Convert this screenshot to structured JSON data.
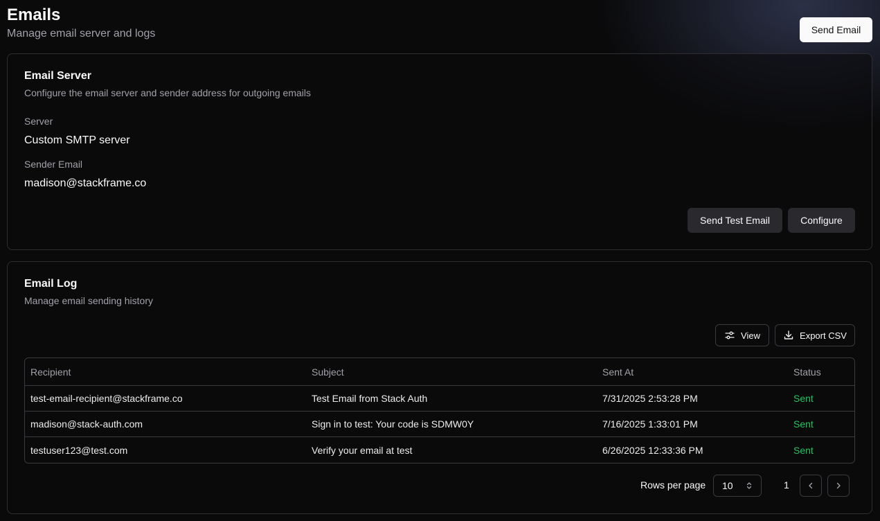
{
  "header": {
    "title": "Emails",
    "subtitle": "Manage email server and logs",
    "send_email_label": "Send Email"
  },
  "email_server": {
    "title": "Email Server",
    "description": "Configure the email server and sender address for outgoing emails",
    "server_label": "Server",
    "server_value": "Custom SMTP server",
    "sender_label": "Sender Email",
    "sender_value": "madison@stackframe.co",
    "send_test_label": "Send Test Email",
    "configure_label": "Configure"
  },
  "email_log": {
    "title": "Email Log",
    "description": "Manage email sending history",
    "view_label": "View",
    "view_icon": "sliders-icon",
    "export_label": "Export CSV",
    "export_icon": "download-icon",
    "columns": [
      "Recipient",
      "Subject",
      "Sent At",
      "Status"
    ],
    "rows": [
      {
        "recipient": "test-email-recipient@stackframe.co",
        "subject": "Test Email from Stack Auth",
        "sent_at": "7/31/2025 2:53:28 PM",
        "status": "Sent"
      },
      {
        "recipient": "madison@stack-auth.com",
        "subject": "Sign in to test: Your code is SDMW0Y",
        "sent_at": "7/16/2025 1:33:01 PM",
        "status": "Sent"
      },
      {
        "recipient": "testuser123@test.com",
        "subject": "Verify your email at test",
        "sent_at": "6/26/2025 12:33:36 PM",
        "status": "Sent"
      }
    ],
    "status_color": "#22c55e",
    "pagination": {
      "rows_per_page_label": "Rows per page",
      "rows_per_page_value": "10",
      "current_page": "1"
    }
  }
}
